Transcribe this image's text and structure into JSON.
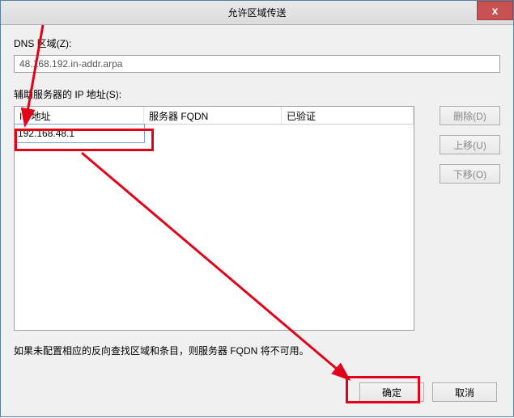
{
  "window": {
    "title": "允许区域传送",
    "close_label": "x"
  },
  "labels": {
    "dns_zone": "DNS 区域(Z):",
    "aux_servers": "辅助服务器的 IP 地址(S):",
    "note": "如果未配置相应的反向查找区域和条目，则服务器 FQDN 将不可用。"
  },
  "fields": {
    "dns_zone_value": "48.168.192.in-addr.arpa",
    "ip_entry_value": "192.168.48.1"
  },
  "listview": {
    "col_ip": "IP 地址",
    "col_fqdn": "服务器 FQDN",
    "col_verified": "已验证"
  },
  "buttons": {
    "delete": "删除(D)",
    "move_up": "上移(U)",
    "move_down": "下移(O)",
    "ok": "确定",
    "cancel": "取消"
  }
}
